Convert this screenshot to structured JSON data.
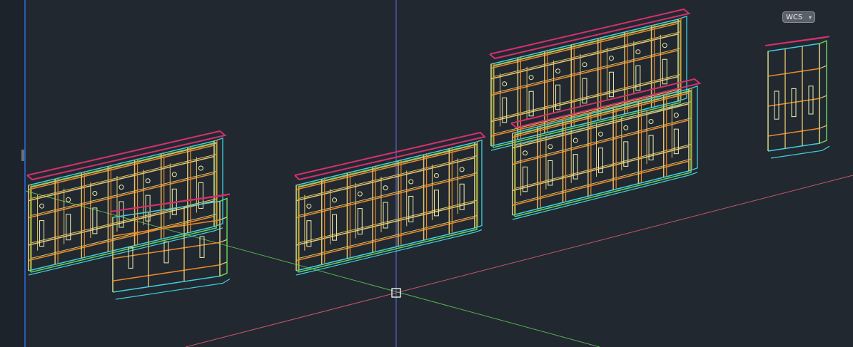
{
  "app": "AutoCAD",
  "viewport": {
    "background_color": "#212830",
    "ucs_badge": {
      "label": "WCS",
      "has_dropdown": true
    },
    "axes": {
      "x_axis_color": "#c6566a",
      "y_axis_color": "#56b14f",
      "z_axis_color": "#6c6fe0"
    },
    "crosshair_cursor": {
      "color": "#ffffff"
    }
  },
  "model": {
    "objects": [
      {
        "type": "cabinet-run"
      },
      {
        "type": "corner-cabinet"
      },
      {
        "type": "cabinet-run"
      },
      {
        "type": "cabinet-run-upper"
      },
      {
        "type": "cabinet-run-lower"
      },
      {
        "type": "corner-cabinet"
      }
    ],
    "layer_colors": [
      "#e0c36a",
      "#e8882a",
      "#d4306e",
      "#3fd0e0",
      "#6ad05a",
      "#f0f0b0"
    ]
  }
}
